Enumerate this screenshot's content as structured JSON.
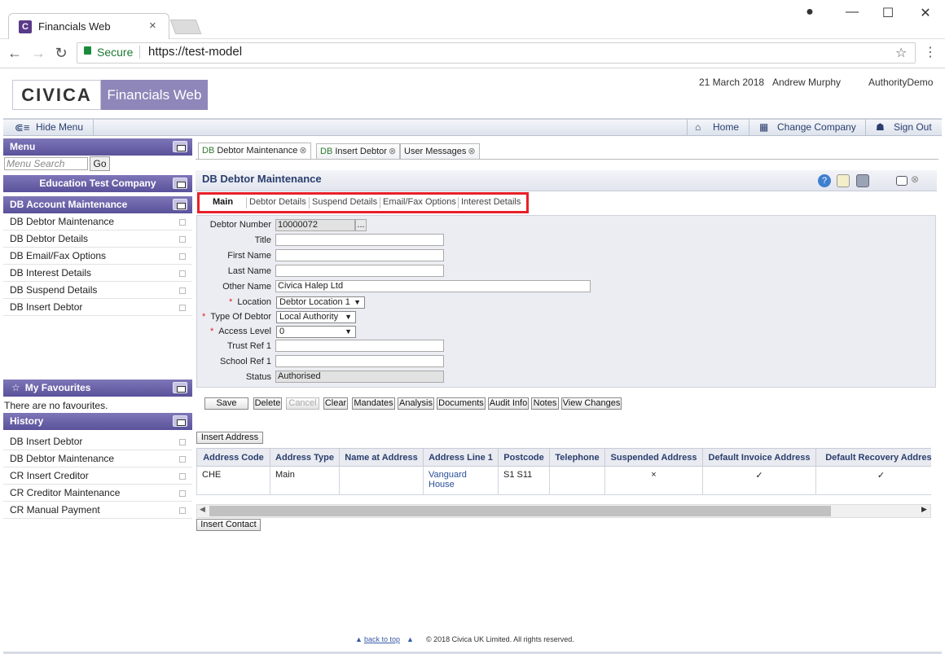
{
  "browser": {
    "tab_title": "Financials Web",
    "tab_icon_letter": "C",
    "secure_label": "Secure",
    "url": "https://test-model"
  },
  "header": {
    "logo": "CIVICA",
    "product": "Financials Web",
    "date": "21 March 2018",
    "user": "Andrew Murphy",
    "authority": "AuthorityDemo"
  },
  "menubar": {
    "hide_menu": "Hide Menu",
    "home": "Home",
    "change_company": "Change Company",
    "sign_out": "Sign Out"
  },
  "sidebar": {
    "menu_title": "Menu",
    "search_placeholder": "Menu Search",
    "go_label": "Go",
    "company": "Education Test Company",
    "section": "DB Account Maintenance",
    "items": [
      "DB Debtor Maintenance",
      "DB Debtor Details",
      "DB Email/Fax Options",
      "DB Interest Details",
      "DB Suspend Details",
      "DB Insert Debtor"
    ],
    "favourites_title": "My Favourites",
    "favourites_empty": "There are no favourites.",
    "history_title": "History",
    "history": [
      "DB Insert Debtor",
      "DB Debtor Maintenance",
      "CR Insert Creditor",
      "CR Creditor Maintenance",
      "CR Manual Payment"
    ]
  },
  "tabs": [
    {
      "prefix": "DB",
      "label": "Debtor Maintenance"
    },
    {
      "prefix": "DB",
      "label": "Insert Debtor"
    },
    {
      "prefix": "",
      "label": "User Messages"
    }
  ],
  "form": {
    "title": "DB Debtor Maintenance",
    "subtabs": [
      "Main",
      "Debtor Details",
      "Suspend Details",
      "Email/Fax Options",
      "Interest Details"
    ],
    "labels": {
      "debtor_number": "Debtor Number",
      "title": "Title",
      "first_name": "First Name",
      "last_name": "Last Name",
      "other_name": "Other Name",
      "location": "Location",
      "type_of_debtor": "Type Of Debtor",
      "access_level": "Access Level",
      "trust_ref": "Trust Ref 1",
      "school_ref": "School Ref 1",
      "status": "Status"
    },
    "values": {
      "debtor_number": "10000072",
      "lookup": "...",
      "title": "",
      "first_name": "",
      "last_name": "",
      "other_name": "Civica Halep Ltd",
      "location": "Debtor Location 1",
      "type_of_debtor": "Local Authority",
      "access_level": "0",
      "trust_ref": "",
      "school_ref": "",
      "status": "Authorised"
    },
    "required_mark": "*"
  },
  "actions": [
    "Save",
    "Delete",
    "Cancel",
    "Clear",
    "Mandates",
    "Analysis",
    "Documents",
    "Audit Info",
    "Notes",
    "View Changes"
  ],
  "address": {
    "insert_label": "Insert Address",
    "columns": [
      "Address Code",
      "Address Type",
      "Name at Address",
      "Address Line 1",
      "Postcode",
      "Telephone",
      "Suspended Address",
      "Default Invoice Address",
      "Default Recovery Address"
    ],
    "row": {
      "code": "CHE",
      "type": "Main",
      "name": "",
      "line1": "Vanguard House",
      "postcode": "S1 S11",
      "telephone": "",
      "suspended": "×",
      "default_invoice": "✓",
      "default_recovery": "✓"
    }
  },
  "insert_contact": "Insert Contact",
  "footer": {
    "back_to_top": "back to top",
    "copyright": "© 2018 Civica UK Limited. All rights reserved."
  }
}
